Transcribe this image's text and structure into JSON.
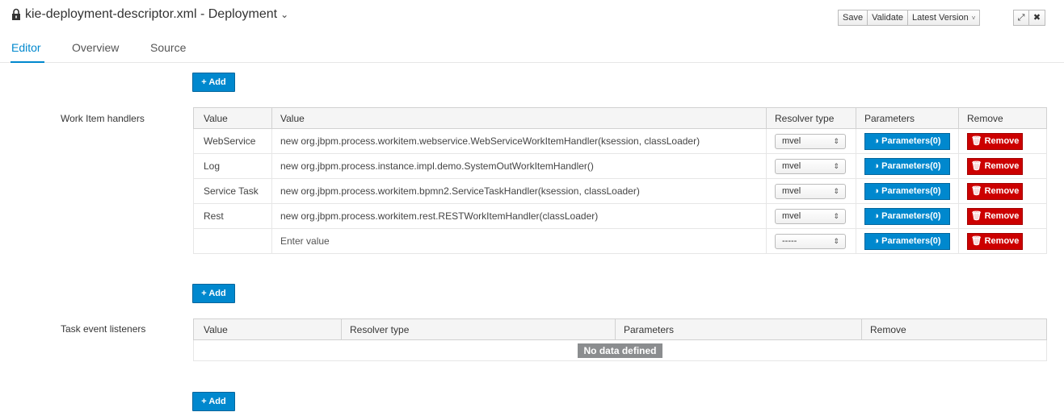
{
  "header": {
    "title": "kie-deployment-descriptor.xml - Deployment",
    "title_caret": "⌄",
    "save_label": "Save",
    "validate_label": "Validate",
    "version_label": "Latest Version",
    "version_caret": "˅",
    "expand_glyph": "⤢",
    "close_glyph": "✖"
  },
  "tabs": [
    {
      "label": "Editor",
      "active": true
    },
    {
      "label": "Overview",
      "active": false
    },
    {
      "label": "Source",
      "active": false
    }
  ],
  "add_label": "+ Add",
  "work_item_handlers": {
    "label": "Work Item handlers",
    "columns": [
      "Value",
      "Value",
      "Resolver type",
      "Parameters",
      "Remove"
    ],
    "rows": [
      {
        "name": "WebService",
        "value": "new org.jbpm.process.workitem.webservice.WebServiceWorkItemHandler(ksession, classLoader)",
        "resolver": "mvel",
        "parameters": "Parameters(0)",
        "remove": "Remove"
      },
      {
        "name": "Log",
        "value": "new org.jbpm.process.instance.impl.demo.SystemOutWorkItemHandler()",
        "resolver": "mvel",
        "parameters": "Parameters(0)",
        "remove": "Remove"
      },
      {
        "name": "Service Task",
        "value": "new org.jbpm.process.workitem.bpmn2.ServiceTaskHandler(ksession, classLoader)",
        "resolver": "mvel",
        "parameters": "Parameters(0)",
        "remove": "Remove"
      },
      {
        "name": "Rest",
        "value": "new org.jbpm.process.workitem.rest.RESTWorkItemHandler(classLoader)",
        "resolver": "mvel",
        "parameters": "Parameters(0)",
        "remove": "Remove"
      },
      {
        "name": "",
        "value": "Enter value",
        "resolver": "-----",
        "parameters": "Parameters(0)",
        "remove": "Remove"
      }
    ]
  },
  "task_event_listeners": {
    "label": "Task event listeners",
    "columns": [
      "Value",
      "Resolver type",
      "Parameters",
      "Remove"
    ],
    "empty_text": "No data defined"
  },
  "colors": {
    "primary": "#0088ce",
    "danger": "#cc0000",
    "nodata": "#8b8d8f"
  }
}
